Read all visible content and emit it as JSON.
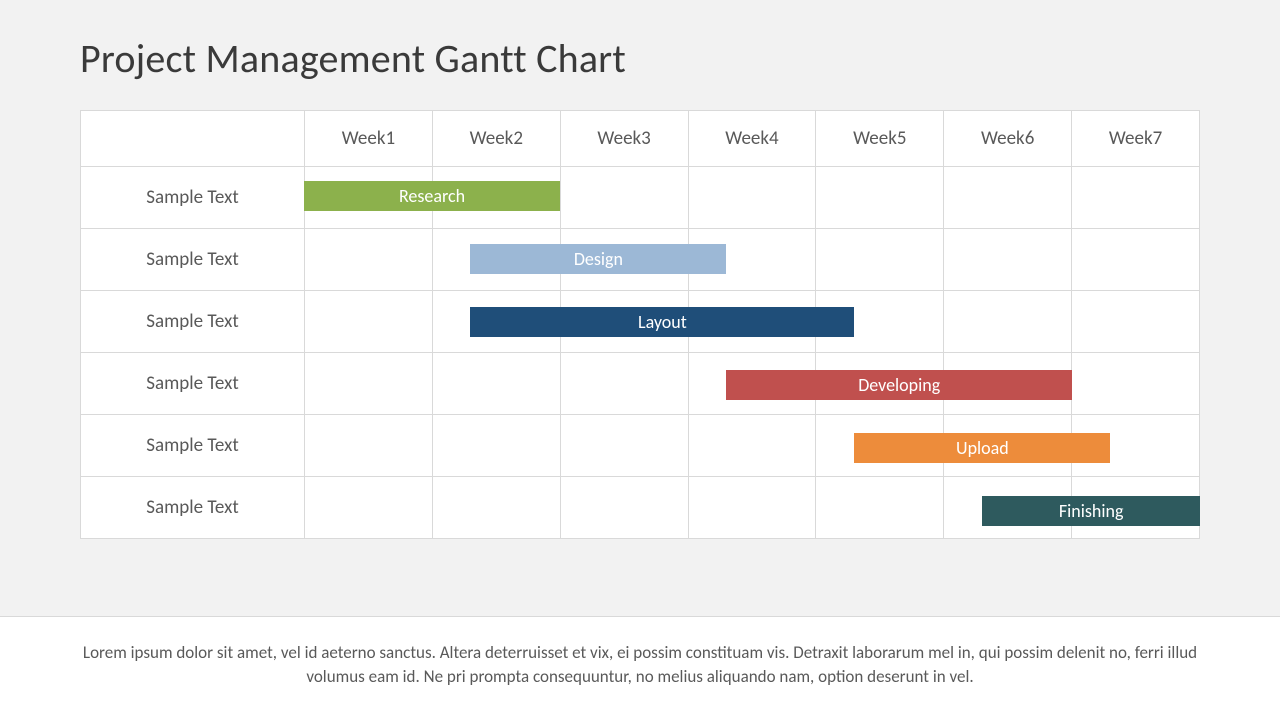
{
  "title": "Project Management Gantt Chart",
  "columns": [
    "Week1",
    "Week2",
    "Week3",
    "Week4",
    "Week5",
    "Week6",
    "Week7"
  ],
  "row_label": "Sample Text",
  "footer_text": "Lorem ipsum dolor sit amet, vel id aeterno sanctus. Altera deterruisset et vix, ei possim constituam vis. Detraxit laborarum mel in, qui possim delenit no, ferri illud volumus eam id. Ne pri prompta consequuntur, no melius aliquando nam, option deserunt in vel.",
  "chart_data": {
    "type": "bar",
    "orientation": "horizontal-gantt",
    "title": "Project Management Gantt Chart",
    "xlabel": "Week",
    "x_categories": [
      "Week1",
      "Week2",
      "Week3",
      "Week4",
      "Week5",
      "Week6",
      "Week7"
    ],
    "x_range_weeks": [
      1,
      7
    ],
    "tasks": [
      {
        "row": 1,
        "name": "Research",
        "start_week": 1.0,
        "end_week": 3.0,
        "color": "#8cb14c"
      },
      {
        "row": 2,
        "name": "Design",
        "start_week": 2.3,
        "end_week": 4.3,
        "color": "#9cb8d6"
      },
      {
        "row": 3,
        "name": "Layout",
        "start_week": 2.3,
        "end_week": 5.3,
        "color": "#1f4e79"
      },
      {
        "row": 4,
        "name": "Developing",
        "start_week": 4.3,
        "end_week": 7.0,
        "color": "#c0504e"
      },
      {
        "row": 5,
        "name": "Upload",
        "start_week": 5.3,
        "end_week": 7.3,
        "color": "#ed8c3b"
      },
      {
        "row": 6,
        "name": "Finishing",
        "start_week": 6.3,
        "end_week": 8.0,
        "color": "#2e5a5e"
      }
    ]
  }
}
